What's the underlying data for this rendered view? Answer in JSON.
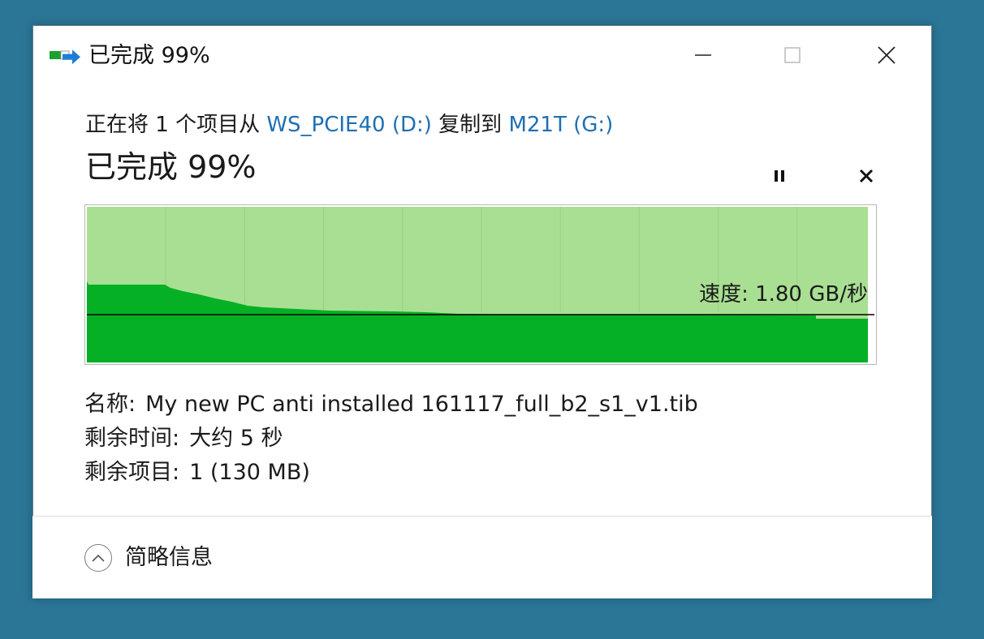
{
  "window": {
    "title": "已完成 99%",
    "app_icon": "copy-transfer-icon",
    "controls": {
      "minimize": "minimize-icon",
      "maximize": "maximize-icon",
      "close": "close-icon"
    }
  },
  "transfer": {
    "prefix": "正在将 1 个项目从 ",
    "source": "WS_PCIE40 (D:)",
    "middle": " 复制到 ",
    "destination": "M21T (G:)",
    "progress_text": "已完成 99%",
    "progress_value": 0.99,
    "pause_icon": "pause-icon",
    "cancel_icon": "cancel-icon"
  },
  "graph": {
    "speed_text": "速度: 1.80 GB/秒",
    "fill_color": "#06b025",
    "background_color": "#a9df93",
    "line_color": "#000000"
  },
  "details": {
    "name_label": "名称:",
    "name_value": "My new PC anti installed 161117_full_b2_s1_v1.tib",
    "time_label": "剩余时间:",
    "time_value": "大约 5 秒",
    "items_label": "剩余项目:",
    "items_value": "1 (130 MB)"
  },
  "footer": {
    "toggle_label": "简略信息",
    "toggle_icon": "chevron-up-icon"
  }
}
